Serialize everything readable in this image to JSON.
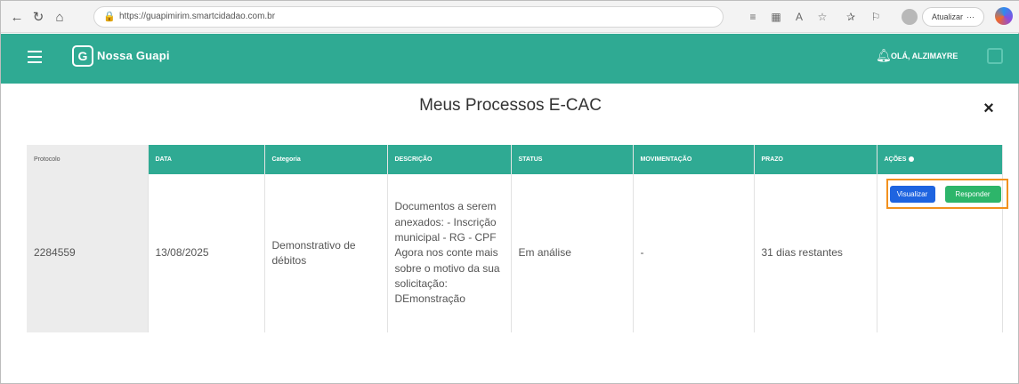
{
  "browser": {
    "url": "https://guapimirim.smartcidadao.com.br",
    "update_label": "Atualizar",
    "update_more": "···"
  },
  "app": {
    "brand": "Nossa Guapi",
    "logo_letter": "G",
    "user": "OLÁ, ALZIMAYRE"
  },
  "modal": {
    "title": "Meus Processos E-CAC",
    "close": "×"
  },
  "table": {
    "headers": [
      "Protocolo",
      "DATA",
      "Categoria",
      "DESCRIÇÃO",
      "STATUS",
      "MOVIMENTAÇÃO",
      "PRAZO",
      "AÇÕES"
    ],
    "rows": [
      {
        "protocolo": "2284559",
        "data": "13/08/2025",
        "categoria": "Demonstrativo de débitos",
        "descricao": "Documentos a serem anexados: - Inscrição municipal - RG - CPF Agora nos conte mais sobre o motivo da sua solicitação: DEmonstração",
        "status": "Em análise",
        "movimentacao": "-",
        "prazo": "31 dias restantes",
        "acoes": {
          "visualizar": "Visualizar",
          "responder": "Responder"
        }
      }
    ]
  },
  "colors": {
    "header": "#2faa93",
    "visualizar": "#1e64e0",
    "responder": "#2db56a",
    "highlight": "#f2911e"
  }
}
